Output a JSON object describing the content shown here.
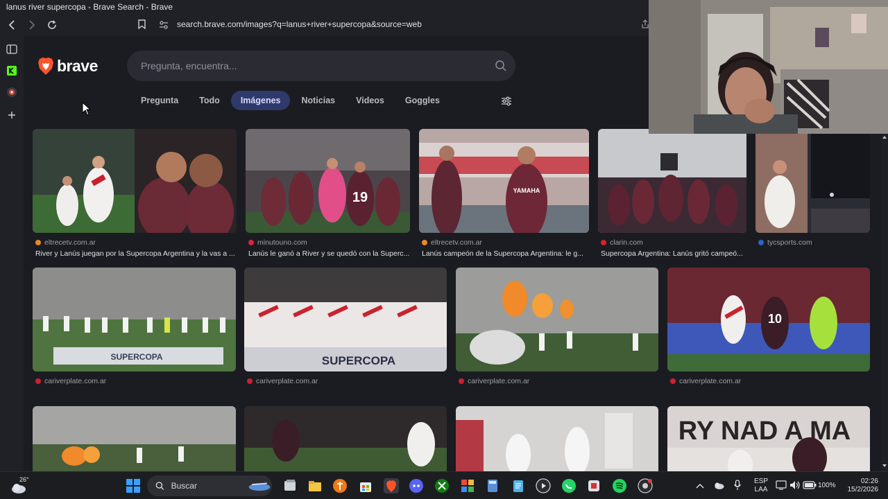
{
  "window": {
    "title": "lanus river supercopa - Brave Search - Brave"
  },
  "address": {
    "url": "search.brave.com/images?q=lanus+river+supercopa&source=web"
  },
  "brand": {
    "name": "brave",
    "accent": "#fb542b"
  },
  "search": {
    "placeholder": "Pregunta, encuentra..."
  },
  "tabs": [
    {
      "label": "Pregunta",
      "active": false
    },
    {
      "label": "Todo",
      "active": false
    },
    {
      "label": "Imágenes",
      "active": true
    },
    {
      "label": "Noticias",
      "active": false
    },
    {
      "label": "Videos",
      "active": false
    },
    {
      "label": "Goggles",
      "active": false
    }
  ],
  "results": {
    "row1": [
      {
        "source": "eltrecetv.com.ar",
        "title": "River y Lanús juegan por la Supercopa Argentina y la vas a ...",
        "fav": "#e7882b"
      },
      {
        "source": "minutouno.com",
        "title": "Lanús le ganó a River y se quedó con la Superc...",
        "fav": "#d8243f"
      },
      {
        "source": "eltrecetv.com.ar",
        "title": "Lanús campeón de la Supercopa Argentina: le g...",
        "fav": "#e7882b"
      },
      {
        "source": "clarin.com",
        "title": "Supercopa Argentina: Lanús gritó campeó...",
        "fav": "#d5222a"
      },
      {
        "source": "tycsports.com",
        "title": "",
        "fav": "#2a64c8"
      }
    ],
    "row2": [
      {
        "source": "cariverplate.com.ar",
        "fav": "#cf2030"
      },
      {
        "source": "cariverplate.com.ar",
        "fav": "#cf2030"
      },
      {
        "source": "cariverplate.com.ar",
        "fav": "#cf2030"
      },
      {
        "source": "cariverplate.com.ar",
        "fav": "#cf2030"
      }
    ],
    "image_texts": {
      "supercopa1": "SUPERCOPA",
      "supercopa2": "SUPERCOPA",
      "jersey19": "19",
      "jersey10": "10",
      "yamaha": "YAMAHA",
      "banner": "RY NAD A MA"
    }
  },
  "taskbar": {
    "weather": "26°",
    "search_label": "Buscar",
    "lang_top": "ESP",
    "lang_bottom": "LAA",
    "battery": "100%",
    "time": "02:26",
    "date": "15/2/2026"
  }
}
